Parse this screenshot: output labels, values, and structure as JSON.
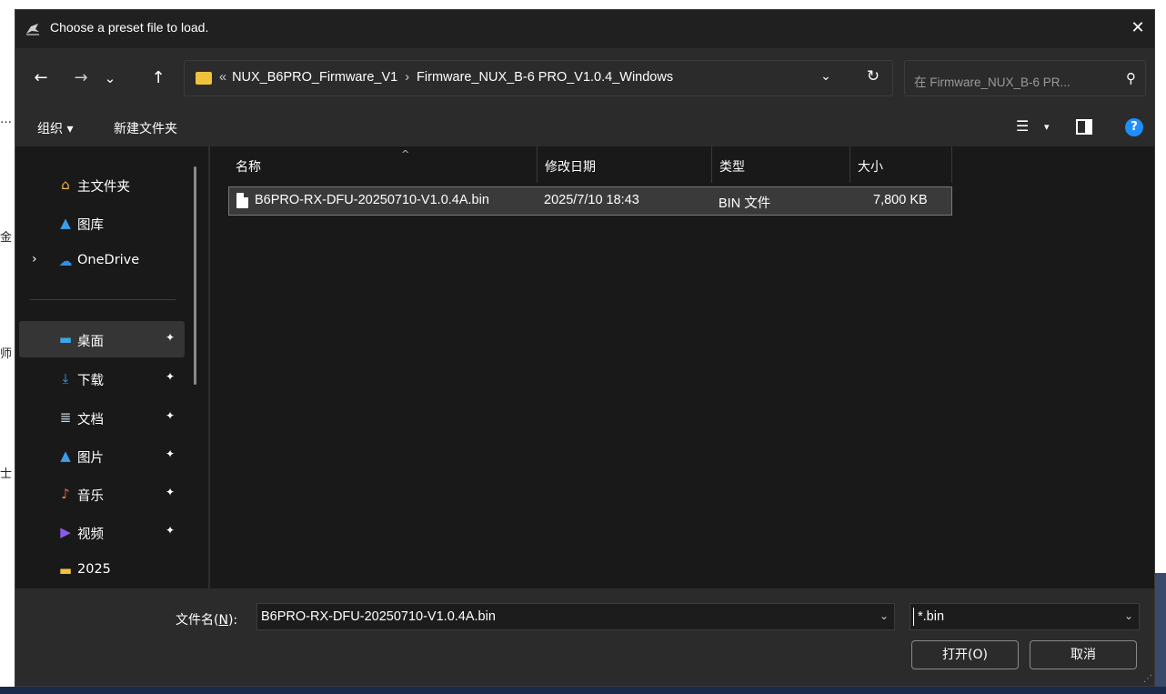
{
  "window": {
    "title": "Choose a preset file to load.",
    "close_symbol": "✕"
  },
  "nav": {
    "back_symbol": "←",
    "forward_symbol": "→",
    "recent_symbol": "⌄",
    "up_symbol": "↑",
    "address_overflow": "«",
    "breadcrumb": [
      "NUX_B6PRO_Firmware_V1",
      "Firmware_NUX_B-6 PRO_V1.0.4_Windows"
    ],
    "breadcrumb_sep": "›",
    "address_dropdown_symbol": "⌄",
    "refresh_symbol": "↻",
    "search_placeholder": "在 Firmware_NUX_B-6 PR...",
    "search_symbol": "⚲"
  },
  "toolbar": {
    "organize_label": "组织 ▾",
    "new_folder_label": "新建文件夹",
    "view_symbol": "☰",
    "view_dropdown_symbol": "▾",
    "help_symbol": "?"
  },
  "sidebar": {
    "items": [
      {
        "label": "主文件夹",
        "icon": "home-icon",
        "glyph": "⌂",
        "color": "#f7b350"
      },
      {
        "label": "图库",
        "icon": "gallery-icon",
        "glyph": "▲",
        "color": "#3b9ee8"
      },
      {
        "label": "OneDrive",
        "icon": "cloud-icon",
        "glyph": "☁",
        "color": "#2f8fe8"
      },
      {
        "label": "桌面",
        "icon": "desktop-icon",
        "glyph": "▬",
        "color": "#3aa8e8"
      },
      {
        "label": "下载",
        "icon": "download-icon",
        "glyph": "⤓",
        "color": "#3ba3f0"
      },
      {
        "label": "文档",
        "icon": "document-icon",
        "glyph": "≣",
        "color": "#c9d6e8"
      },
      {
        "label": "图片",
        "icon": "pictures-icon",
        "glyph": "▲",
        "color": "#3b9ee8"
      },
      {
        "label": "音乐",
        "icon": "music-icon",
        "glyph": "♪",
        "color": "#e8704a"
      },
      {
        "label": "视频",
        "icon": "video-icon",
        "glyph": "▶",
        "color": "#8a5ce8"
      },
      {
        "label": "2025",
        "icon": "folder-icon",
        "glyph": "▬",
        "color": "#f0c23c"
      }
    ],
    "pin_symbol": "📌",
    "expand_symbol": "›"
  },
  "filelist": {
    "columns": [
      "名称",
      "修改日期",
      "类型",
      "大小"
    ],
    "sort_symbol": "^",
    "rows": [
      {
        "name": "B6PRO-RX-DFU-20250710-V1.0.4A.bin",
        "modified": "2025/7/10 18:43",
        "type": "BIN 文件",
        "size": "7,800 KB"
      }
    ]
  },
  "footer": {
    "filename_label_pre": "文件名(",
    "filename_label_key": "N",
    "filename_label_post": "):",
    "filename_value": "B6PRO-RX-DFU-20250710-V1.0.4A.bin",
    "filter_value": "*.bin",
    "open_label": "打开(O)",
    "cancel_label": "取消",
    "dropdown_symbol": "⌄"
  },
  "background": {
    "glyphs": [
      "…",
      "金",
      "师",
      "士"
    ]
  },
  "colors": {
    "accent": "#1f8fff",
    "folder": "#f0c23c",
    "window_bg": "#202020",
    "pane_bg": "#191919"
  }
}
